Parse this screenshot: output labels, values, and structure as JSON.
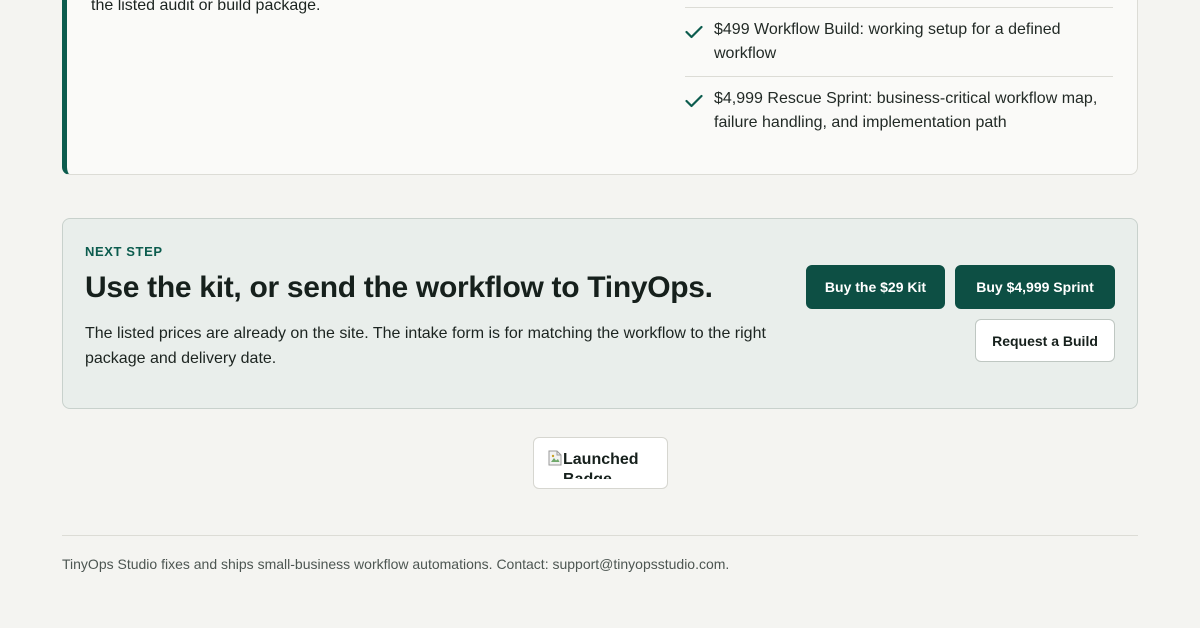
{
  "offer_card": {
    "left_text": "the listed audit or build package.",
    "items": [
      {
        "icon": "check-icon",
        "text": "$499 Workflow Build: working setup for a defined workflow"
      },
      {
        "icon": "check-icon",
        "text": "$4,999 Rescue Sprint: business-critical workflow map, failure handling, and implementation path"
      }
    ]
  },
  "next_step": {
    "eyebrow": "NEXT STEP",
    "title": "Use the kit, or send the workflow to TinyOps.",
    "description": "The listed prices are already on the site. The intake form is for matching the workflow to the right package and delivery date.",
    "buttons": {
      "kit": "Buy the $29 Kit",
      "sprint": "Buy $4,999 Sprint",
      "request": "Request a Build"
    }
  },
  "badge": {
    "alt_text": "Launched Badge",
    "icon": "broken-image-icon"
  },
  "footer": {
    "text": "TinyOps Studio fixes and ships small-business workflow automations. Contact: support@tinyopsstudio.com."
  },
  "colors": {
    "accent": "#0c5c4e",
    "button_primary": "#0d4f44",
    "page_bg": "#f4f4f1",
    "next_card_bg": "#e9eeeb"
  }
}
